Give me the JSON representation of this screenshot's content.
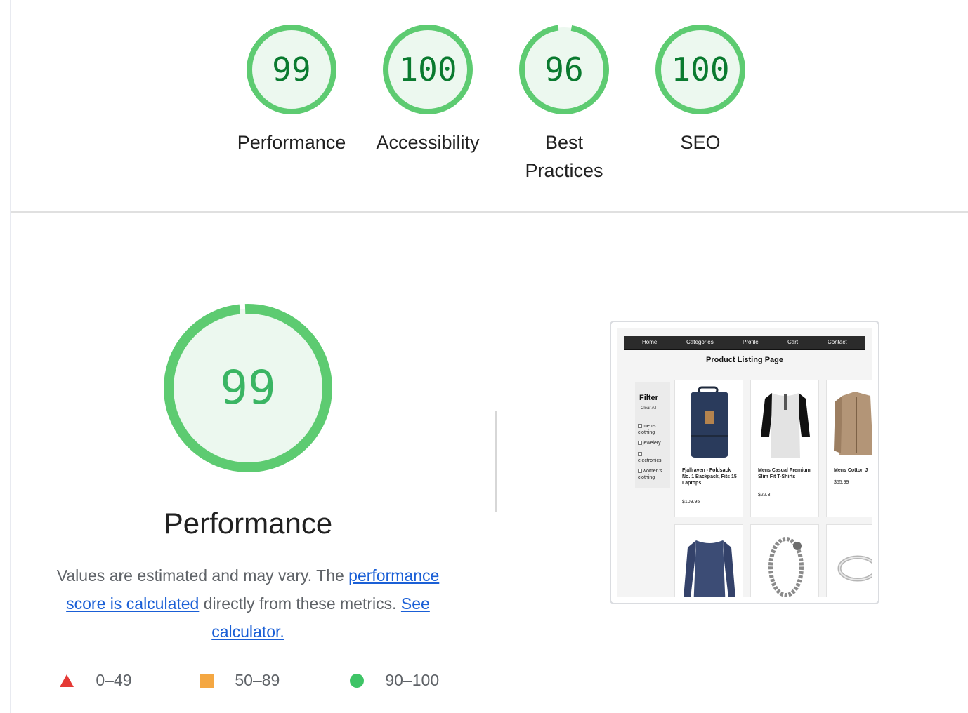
{
  "colors": {
    "pass_green": "#0cce6b",
    "pass_fill": "#e6f7ec",
    "fail_red": "#e53935",
    "average_orange": "#f4a742",
    "link_blue": "#1a5fd6"
  },
  "categories": [
    {
      "score": "99",
      "value": 99,
      "label": "Performance"
    },
    {
      "score": "100",
      "value": 100,
      "label": "Accessibility"
    },
    {
      "score": "96",
      "value": 96,
      "label": "Best Practices"
    },
    {
      "score": "100",
      "value": 100,
      "label": "SEO"
    }
  ],
  "performance": {
    "score": "99",
    "value": 99,
    "title": "Performance",
    "desc_intro": "Values are estimated and may vary. The ",
    "desc_link1": "performance score is calculated",
    "desc_mid": " directly from these metrics. ",
    "desc_link2": "See calculator."
  },
  "legend": [
    {
      "icon": "triangle-icon",
      "range": "0–49"
    },
    {
      "icon": "square-icon",
      "range": "50–89"
    },
    {
      "icon": "circle-icon",
      "range": "90–100"
    }
  ],
  "screenshot": {
    "nav": [
      "Home",
      "Categories",
      "Profile",
      "Cart",
      "Contact"
    ],
    "page_title": "Product Listing Page",
    "filter_title": "Filter",
    "clear_all": "Clear All",
    "filter_options": [
      "men's clothing",
      "jewelery",
      "electronics",
      "women's clothing"
    ],
    "products": [
      {
        "name": "Fjallraven - Foldsack No. 1 Backpack, Fits 15 Laptops",
        "price": "$109.95",
        "image": "backpack-image"
      },
      {
        "name": "Mens Casual Premium Slim Fit T-Shirts",
        "price": "$22.3",
        "image": "shirt-image"
      },
      {
        "name": "Mens Cotton J",
        "price": "$55.99",
        "image": "jacket-image"
      },
      {
        "name": "",
        "price": "",
        "image": "sweater-image"
      },
      {
        "name": "",
        "price": "",
        "image": "bracelet-image"
      },
      {
        "name": "",
        "price": "",
        "image": "bangle-image"
      }
    ]
  }
}
